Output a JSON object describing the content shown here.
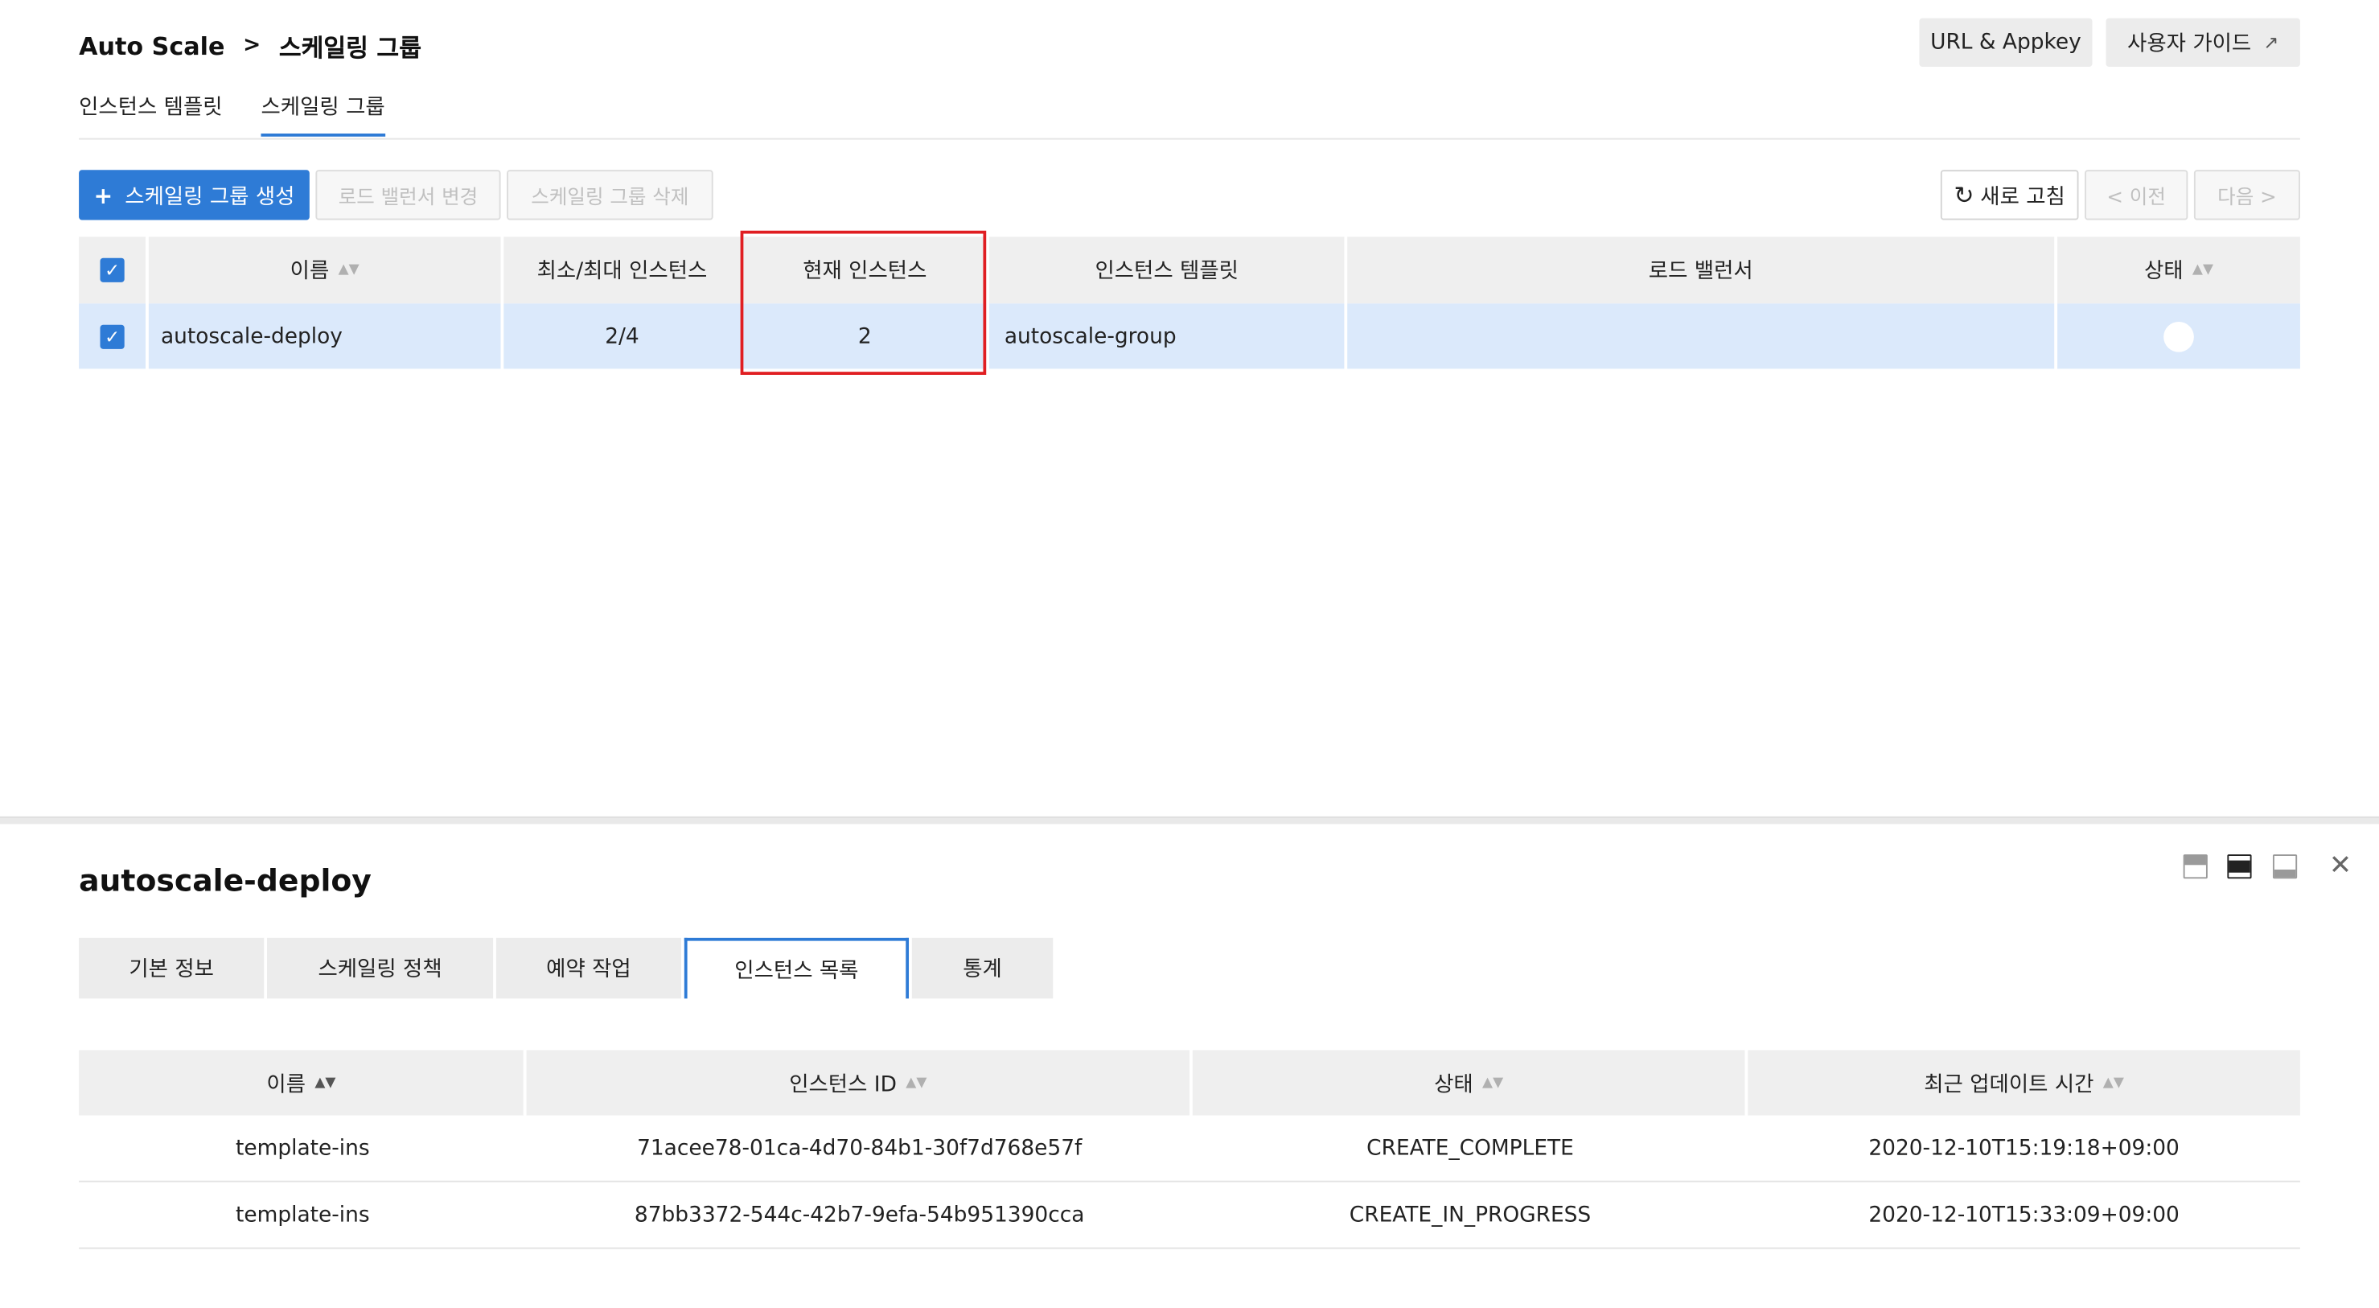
{
  "header": {
    "breadcrumb_root": "Auto Scale",
    "breadcrumb_sep": ">",
    "breadcrumb_current": "스케일링 그룹",
    "url_appkey_label": "URL & Appkey",
    "user_guide_label": "사용자 가이드",
    "external_icon": "↗"
  },
  "subtabs": [
    {
      "label": "인스턴스 템플릿",
      "active": false
    },
    {
      "label": "스케일링 그룹",
      "active": true
    }
  ],
  "toolbar": {
    "create_label": "스케일링 그룹 생성",
    "create_icon": "+",
    "change_lb_label": "로드 밸런서 변경",
    "delete_label": "스케일링 그룹 삭제",
    "refresh_label": "새로 고침",
    "refresh_icon": "↻",
    "prev_label": "< 이전",
    "next_label": "다음 >"
  },
  "groups_table": {
    "headers": [
      "이름",
      "최소/최대 인스턴스",
      "현재 인스턴스",
      "인스턴스 템플릿",
      "로드 밸런서",
      "상태"
    ],
    "rows": [
      {
        "name": "autoscale-deploy",
        "min_max": "2/4",
        "current": "2",
        "template": "autoscale-group",
        "load_balancer": "",
        "checked": true
      }
    ]
  },
  "detail": {
    "title": "autoscale-deploy",
    "close_icon": "✕",
    "tabs": [
      {
        "label": "기본 정보",
        "active": false
      },
      {
        "label": "스케일링 정책",
        "active": false
      },
      {
        "label": "예약 작업",
        "active": false
      },
      {
        "label": "인스턴스 목록",
        "active": true
      },
      {
        "label": "통계",
        "active": false
      }
    ],
    "instances_table": {
      "headers": [
        "이름",
        "인스턴스 ID",
        "상태",
        "최근 업데이트 시간"
      ],
      "rows": [
        {
          "name": "template-ins",
          "id": "71acee78-01ca-4d70-84b1-30f7d768e57f",
          "status": "CREATE_COMPLETE",
          "updated": "2020-12-10T15:19:18+09:00"
        },
        {
          "name": "template-ins",
          "id": "87bb3372-544c-42b7-9efa-54b951390cca",
          "status": "CREATE_IN_PROGRESS",
          "updated": "2020-12-10T15:33:09+09:00"
        }
      ]
    }
  },
  "colors": {
    "accent": "#2e7bd6",
    "selected_row": "#dbe9fb",
    "highlight_border": "#e01e22",
    "header_bg": "#efefef"
  }
}
